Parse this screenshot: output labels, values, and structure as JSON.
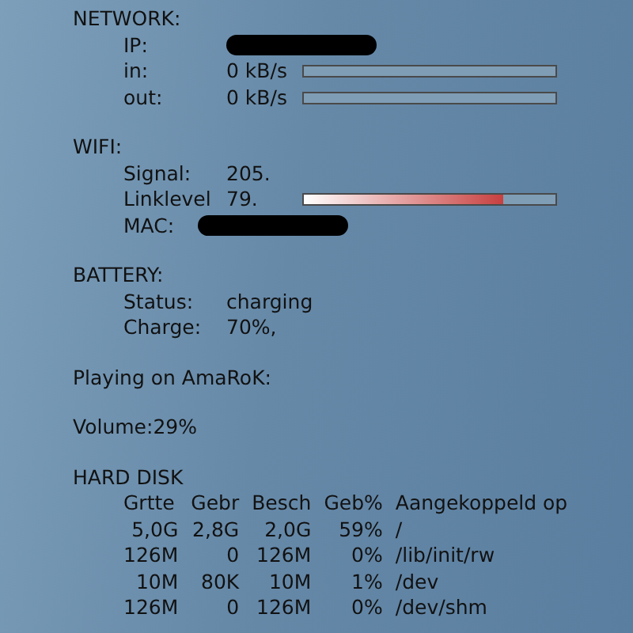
{
  "sections": [
    {
      "title": "NETWORK:",
      "rows": [
        {
          "kind": "redacted",
          "label": "IP:"
        },
        {
          "kind": "bar",
          "label": "in:",
          "value": "0 kB/s",
          "level": 0
        },
        {
          "kind": "bar",
          "label": "out:",
          "value": "0 kB/s",
          "level": 0
        }
      ]
    },
    {
      "title": "WIFI:",
      "rows": [
        {
          "kind": "text",
          "label": "Signal:",
          "value": "205."
        },
        {
          "kind": "bar",
          "label": "Linklevel",
          "value": "79.",
          "level": 0.79
        },
        {
          "kind": "redacted",
          "label": "MAC:"
        }
      ]
    },
    {
      "title": "BATTERY:",
      "rows": [
        {
          "kind": "text",
          "label": "Status:",
          "value": "charging"
        },
        {
          "kind": "text",
          "label": "Charge:",
          "value": "70%,"
        }
      ]
    },
    {
      "title": "Playing on AmaRoK:"
    },
    {
      "title": "Volume:29%"
    },
    {
      "title": "HARD DISK",
      "table": {
        "columns": [
          "Grtte",
          "Gebr",
          "Besch",
          "Geb%",
          "Aangekoppeld op"
        ],
        "rows": [
          [
            "5,0G",
            "2,8G",
            "2,0G",
            "59%",
            "/"
          ],
          [
            "126M",
            "0",
            "126M",
            "0%",
            "/lib/init/rw"
          ],
          [
            "10M",
            "80K",
            "10M",
            "1%",
            "/dev"
          ],
          [
            "126M",
            "0",
            "126M",
            "0%",
            "/dev/shm"
          ]
        ]
      }
    }
  ]
}
